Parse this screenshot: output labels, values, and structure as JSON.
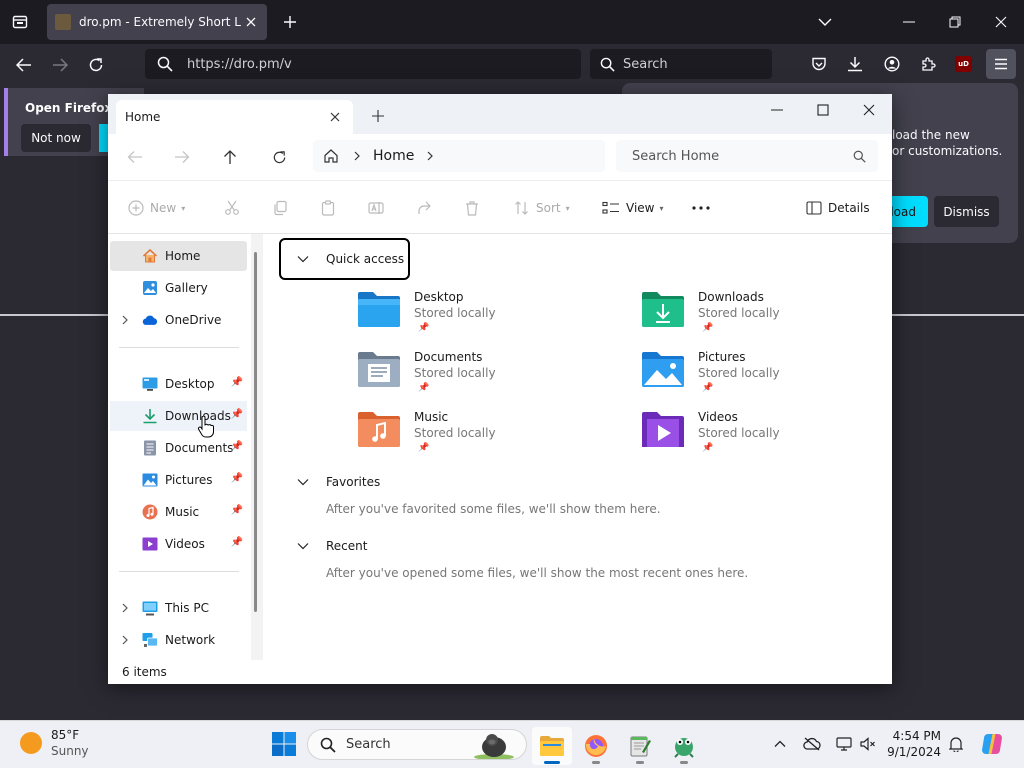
{
  "firefox": {
    "tab_title": "dro.pm - Extremely Short Links",
    "url": "https://dro.pm/v",
    "search_placeholder": "Search",
    "notice_title": "Open Firefox ev",
    "notice_button": "Not now",
    "popup_line1": "load the new",
    "popup_line2": "or customizations.",
    "popup_download": "load",
    "popup_dismiss": "Dismiss",
    "ublock_badge": "uD",
    "accent_color": "#00ddff"
  },
  "explorer": {
    "tab_title": "Home",
    "breadcrumb": "Home",
    "search_placeholder": "Search Home",
    "toolbar": {
      "new": "New",
      "sort": "Sort",
      "view": "View",
      "details": "Details"
    },
    "nav": {
      "home": "Home",
      "gallery": "Gallery",
      "onedrive": "OneDrive",
      "desktop": "Desktop",
      "downloads": "Downloads",
      "documents": "Documents",
      "pictures": "Pictures",
      "music": "Music",
      "videos": "Videos",
      "thispc": "This PC",
      "network": "Network"
    },
    "status": "6 items",
    "groups": {
      "quick_access": "Quick access",
      "favorites": "Favorites",
      "favorites_empty": "After you've favorited some files, we'll show them here.",
      "recent": "Recent",
      "recent_empty": "After you've opened some files, we'll show the most recent ones here."
    },
    "quick_access_items": [
      {
        "name": "Desktop",
        "sub": "Stored locally"
      },
      {
        "name": "Downloads",
        "sub": "Stored locally"
      },
      {
        "name": "Documents",
        "sub": "Stored locally"
      },
      {
        "name": "Pictures",
        "sub": "Stored locally"
      },
      {
        "name": "Music",
        "sub": "Stored locally"
      },
      {
        "name": "Videos",
        "sub": "Stored locally"
      }
    ]
  },
  "taskbar": {
    "temperature": "85°F",
    "condition": "Sunny",
    "search": "Search",
    "time": "4:54 PM",
    "date": "9/1/2024",
    "accent_color": "#0067c0"
  }
}
